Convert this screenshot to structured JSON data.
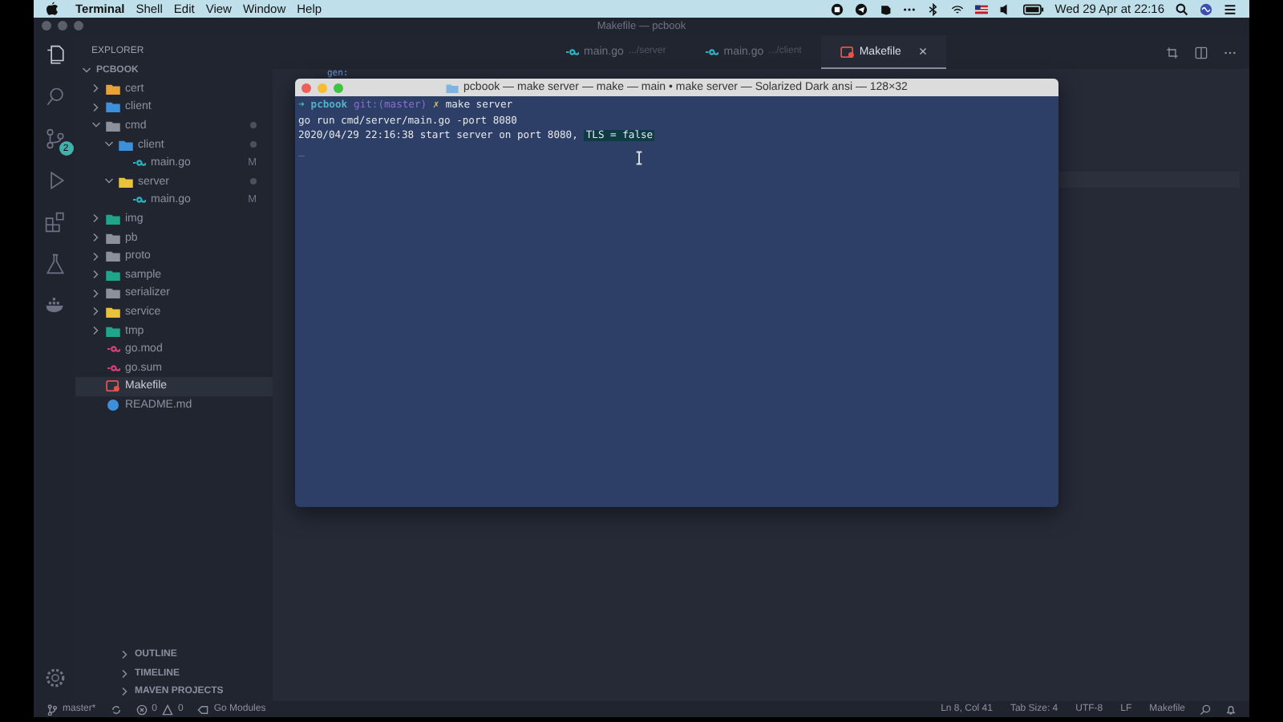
{
  "menu_bar": {
    "app": "Terminal",
    "items": [
      "Shell",
      "Edit",
      "View",
      "Window",
      "Help"
    ],
    "clock": "Wed 29 Apr at 22:16"
  },
  "window": {
    "title": "Makefile — pcbook"
  },
  "activity_bar": {
    "source_control_badge": "2"
  },
  "sidebar": {
    "title": "EXPLORER",
    "root": "PCBOOK",
    "tree": [
      {
        "name": "cert",
        "kind": "folder",
        "color": "#e8a23a",
        "expanded": false,
        "dot": false,
        "selected": false
      },
      {
        "name": "client",
        "kind": "folder",
        "color": "#3d8fd9",
        "expanded": false,
        "dot": false,
        "selected": false
      },
      {
        "name": "cmd",
        "kind": "folder",
        "color": "#8a909c",
        "expanded": true,
        "dot": true,
        "selected": false,
        "children": [
          {
            "name": "client",
            "kind": "folder",
            "color": "#3d8fd9",
            "expanded": true,
            "dot": true,
            "selected": false,
            "children": [
              {
                "name": "main.go",
                "kind": "go",
                "color": "#2bb3c0",
                "status": "M",
                "dot": false,
                "selected": false
              }
            ]
          },
          {
            "name": "server",
            "kind": "folder",
            "color": "#e8c23a",
            "expanded": true,
            "dot": true,
            "selected": false,
            "children": [
              {
                "name": "main.go",
                "kind": "go",
                "color": "#2bb3c0",
                "status": "M",
                "dot": false,
                "selected": false
              }
            ]
          }
        ]
      },
      {
        "name": "img",
        "kind": "folder",
        "color": "#1fa58a",
        "expanded": false,
        "dot": false,
        "selected": false
      },
      {
        "name": "pb",
        "kind": "folder",
        "color": "#8a909c",
        "expanded": false,
        "dot": false,
        "selected": false
      },
      {
        "name": "proto",
        "kind": "folder",
        "color": "#8a909c",
        "expanded": false,
        "dot": false,
        "selected": false
      },
      {
        "name": "sample",
        "kind": "folder",
        "color": "#1fa58a",
        "expanded": false,
        "dot": false,
        "selected": false
      },
      {
        "name": "serializer",
        "kind": "folder",
        "color": "#8a909c",
        "expanded": false,
        "dot": false,
        "selected": false
      },
      {
        "name": "service",
        "kind": "folder",
        "color": "#e8c23a",
        "expanded": false,
        "dot": false,
        "selected": false
      },
      {
        "name": "tmp",
        "kind": "folder",
        "color": "#1fa58a",
        "expanded": false,
        "dot": false,
        "selected": false
      },
      {
        "name": "go.mod",
        "kind": "go",
        "color": "#d9417a",
        "dot": false,
        "selected": false
      },
      {
        "name": "go.sum",
        "kind": "go",
        "color": "#d9417a",
        "dot": false,
        "selected": false
      },
      {
        "name": "Makefile",
        "kind": "makefile",
        "color": "#e5534b",
        "dot": false,
        "selected": true
      },
      {
        "name": "README.md",
        "kind": "readme",
        "color": "#3d8fd9",
        "dot": false,
        "selected": false
      }
    ],
    "panels": [
      "OUTLINE",
      "TIMELINE",
      "MAVEN PROJECTS"
    ]
  },
  "tabs": [
    {
      "label": "main.go",
      "description": ".../server",
      "kind": "go",
      "selected": false
    },
    {
      "label": "main.go",
      "description": ".../client",
      "kind": "go",
      "selected": false
    },
    {
      "label": "Makefile",
      "kind": "makefile",
      "selected": true,
      "close": "×"
    }
  ],
  "editor": {
    "lines": [
      "gen:"
    ]
  },
  "terminal": {
    "title": "pcbook — make server — make — main • make server — Solarized Dark ansi — 128×32",
    "lines": [
      {
        "kind": "prompt",
        "arrow": "➜",
        "dir": "pcbook",
        "git": "git:(master)",
        "mark": "✗",
        "command": "make server"
      },
      {
        "kind": "output",
        "segments": [
          {
            "text": "go run cmd/server/main.go -port 8080",
            "selected": false
          }
        ]
      },
      {
        "kind": "output",
        "segments": [
          {
            "text": "2020/04/29 22:16:38 start server on port 8080,",
            "selected": false
          },
          {
            "text": "TLS = false",
            "selected": true
          }
        ]
      },
      {
        "kind": "cursor",
        "text": "_"
      }
    ]
  },
  "status_bar": {
    "branch": "master*",
    "errors": "0",
    "warnings": "0",
    "go": "Go Modules",
    "right": [
      "Ln 8, Col 41",
      "Tab Size: 4",
      "UTF-8",
      "LF",
      "Makefile"
    ]
  }
}
